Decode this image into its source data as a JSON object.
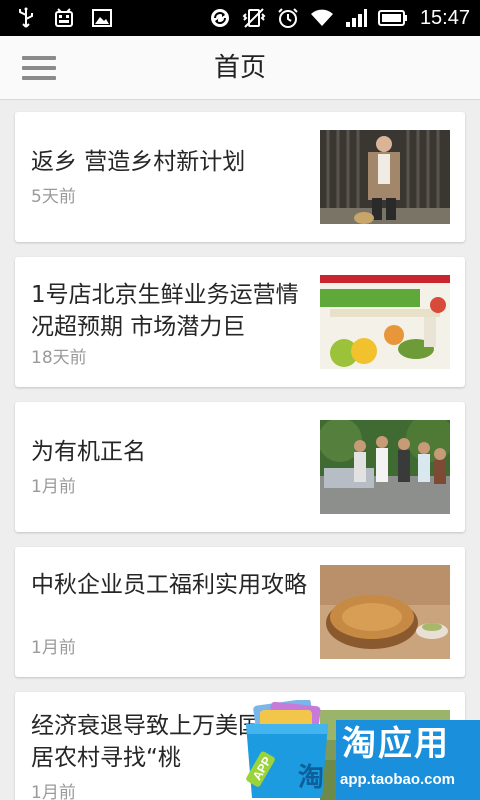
{
  "status_bar": {
    "time": "15:47",
    "left_icons": [
      "usb-icon",
      "android-debug-icon",
      "image-icon"
    ],
    "right_icons": [
      "sync-icon",
      "vibrate-off-icon",
      "alarm-icon",
      "wifi-icon",
      "signal-icon",
      "battery-icon"
    ]
  },
  "header": {
    "title": "首页",
    "menu_icon": "hamburger-menu-icon"
  },
  "feed": [
    {
      "title": "返乡 营造乡村新计划",
      "time": "5天前",
      "image": "man-with-dog-photo"
    },
    {
      "title": "1号店北京生鲜业务运营情况超预期 市场潜力巨",
      "time": "18天前",
      "image": "fresh-produce-ad-photo"
    },
    {
      "title": "为有机正名",
      "time": "1月前",
      "image": "group-of-farmers-photo"
    },
    {
      "title": "中秋企业员工福利实用攻略",
      "time": "1月前",
      "image": "mooncake-photo"
    },
    {
      "title": "经济衰退导致上万美国人迁居农村寻找“桃",
      "time": "1月前",
      "image": "rural-field-photo"
    }
  ],
  "promo": {
    "name": "淘应用",
    "url": "app.taobao.com",
    "bag_label": "淘",
    "tag_label": "APP"
  },
  "colors": {
    "header_bg": "#fafafa",
    "page_bg": "#eeeeee",
    "promo_blue": "#1a8fdc"
  }
}
